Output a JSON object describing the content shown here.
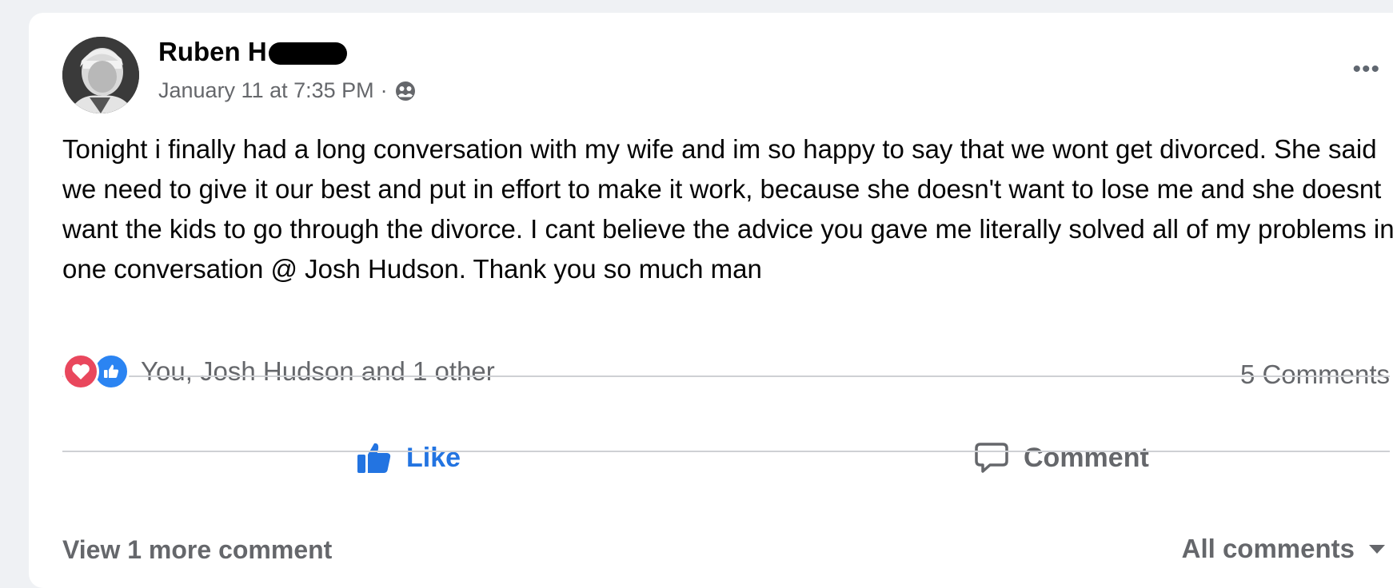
{
  "post": {
    "author": "Ruben H",
    "timestamp": "January 11 at 7:35 PM",
    "separator": "·",
    "audience_icon": "friends-icon",
    "more_label": "•••",
    "body": "Tonight i finally had a long conversation with my wife and im so happy to say that we wont get divorced. She said we need to give it our best and put in effort to make it work, because she doesn't want to lose me and she doesnt want the kids to go through the divorce. I cant believe the advice you gave me literally solved all of my problems in one conversation @ Josh Hudson. Thank you so much man"
  },
  "reactions": {
    "icons": [
      "heart-icon",
      "like-icon"
    ],
    "summary": "You, Josh Hudson and 1 other",
    "comments_count": "5 Comments"
  },
  "actions": {
    "like_label": "Like",
    "comment_label": "Comment"
  },
  "comments": {
    "view_more_label": "View 1 more comment",
    "filter_label": "All comments"
  },
  "colors": {
    "page_bg": "#eff1f4",
    "card_bg": "#ffffff",
    "like_blue": "#2374e1",
    "heart_red": "#e9475d",
    "secondary_text": "#65676b"
  }
}
